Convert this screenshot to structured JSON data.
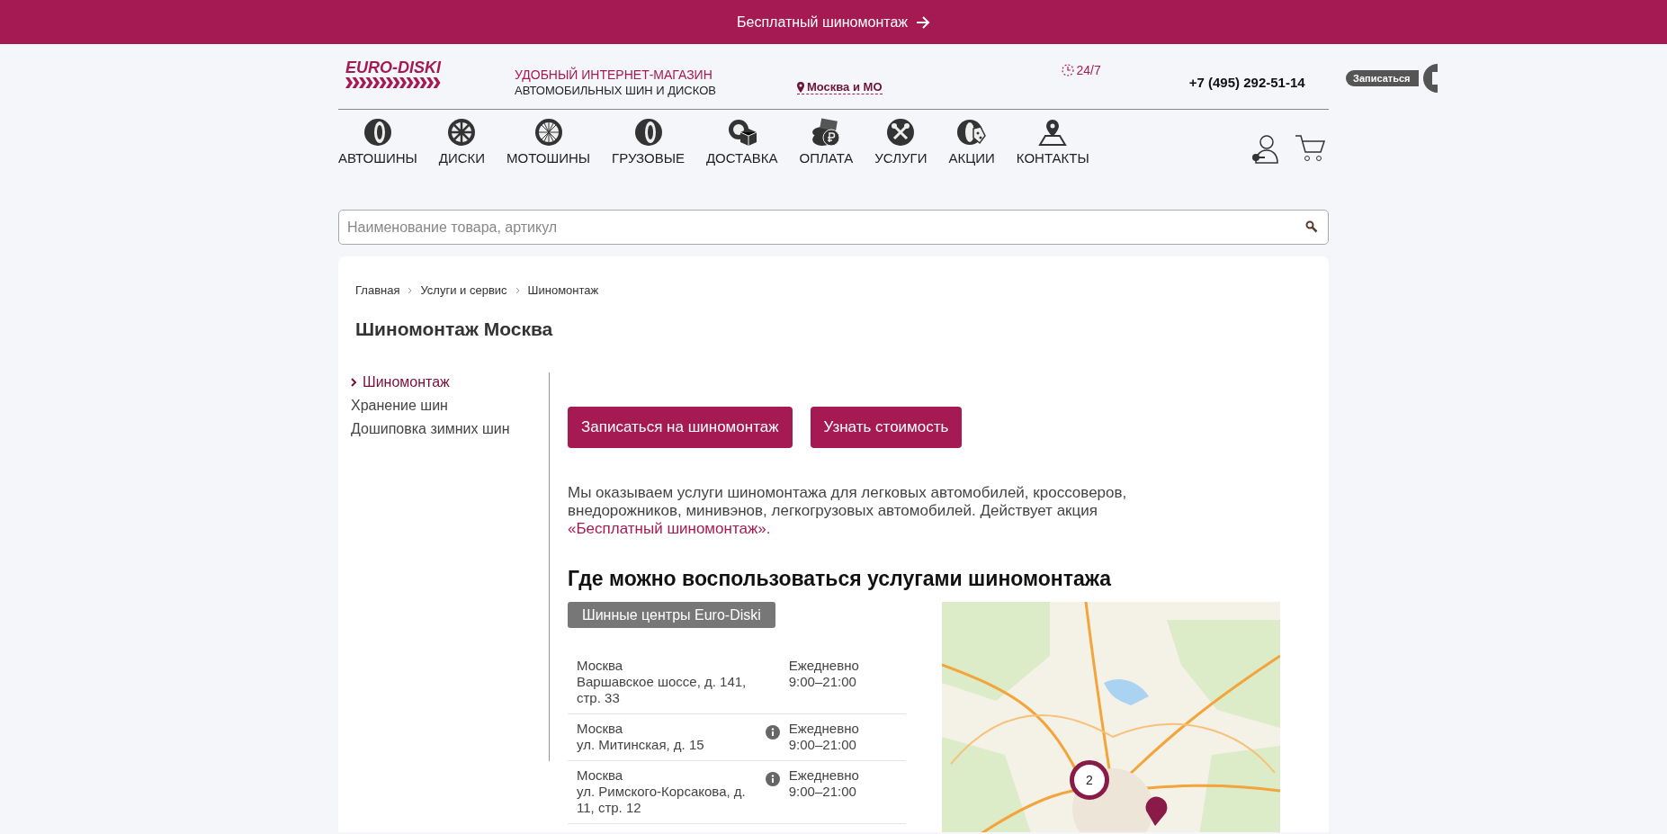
{
  "promo_banner": {
    "text": "Бесплатный шиномонтаж"
  },
  "header": {
    "logo": "EURO-DISKI",
    "tagline_1": "УДОБНЫЙ ИНТЕРНЕТ-МАГАЗИН",
    "tagline_2": "АВТОМОБИЛЬНЫХ ШИН И ДИСКОВ",
    "region": "Москва и МО",
    "hours": "24/7",
    "phone": "+7 (495) 292-51-14",
    "signup_button": "Записаться"
  },
  "nav": [
    {
      "label": "АВТОШИНЫ",
      "kind": "tire"
    },
    {
      "label": "ДИСКИ",
      "kind": "rim"
    },
    {
      "label": "МОТОШИНЫ",
      "kind": "spokes"
    },
    {
      "label": "ГРУЗОВЫЕ",
      "kind": "tire"
    },
    {
      "label": "ДОСТАВКА",
      "kind": "box"
    },
    {
      "label": "ОПЛАТА",
      "kind": "coins"
    },
    {
      "label": "УСЛУГИ",
      "kind": "tools"
    },
    {
      "label": "АКЦИИ",
      "kind": "tag"
    },
    {
      "label": "КОНТАКТЫ",
      "kind": "pin"
    }
  ],
  "search": {
    "placeholder": "Наименование товара, артикул"
  },
  "breadcrumbs": [
    "Главная",
    "Услуги и сервис",
    "Шиномонтаж"
  ],
  "title": "Шиномонтаж Москва",
  "sidebar": {
    "items": [
      {
        "label": "Шиномонтаж",
        "selected": true
      },
      {
        "label": "Хранение шин",
        "selected": false
      },
      {
        "label": "Дошиповка зимних шин",
        "selected": false
      }
    ]
  },
  "actions": [
    "Записаться на шиномонтаж",
    "Узнать стоимость"
  ],
  "intro": {
    "text": "Мы оказываем услуги шиномонтажа для легковых автомобилей, кроссоверов, внедорожников, минивэнов, легкогрузовых автомобилей. Действует акция",
    "link": "«Бесплатный шиномонтаж»."
  },
  "locations": {
    "heading": "Где можно воспользоваться услугами шиномонтажа",
    "filter_button": "Шинные центры Euro-Diski",
    "rows": [
      {
        "city": "Москва",
        "address": "Варшавское шоссе, д. 141, стр. 33",
        "info": false,
        "schedule": "Ежедневно",
        "hours": "9:00–21:00"
      },
      {
        "city": "Москва",
        "address": "ул. Митинская, д. 15",
        "info": true,
        "schedule": "Ежедневно",
        "hours": "9:00–21:00"
      },
      {
        "city": "Москва",
        "address": "ул. Римского-Корсакова, д. 11, стр. 12",
        "info": true,
        "schedule": "Ежедневно",
        "hours": "9:00–21:00"
      }
    ]
  },
  "map": {
    "cluster_count": "2"
  }
}
